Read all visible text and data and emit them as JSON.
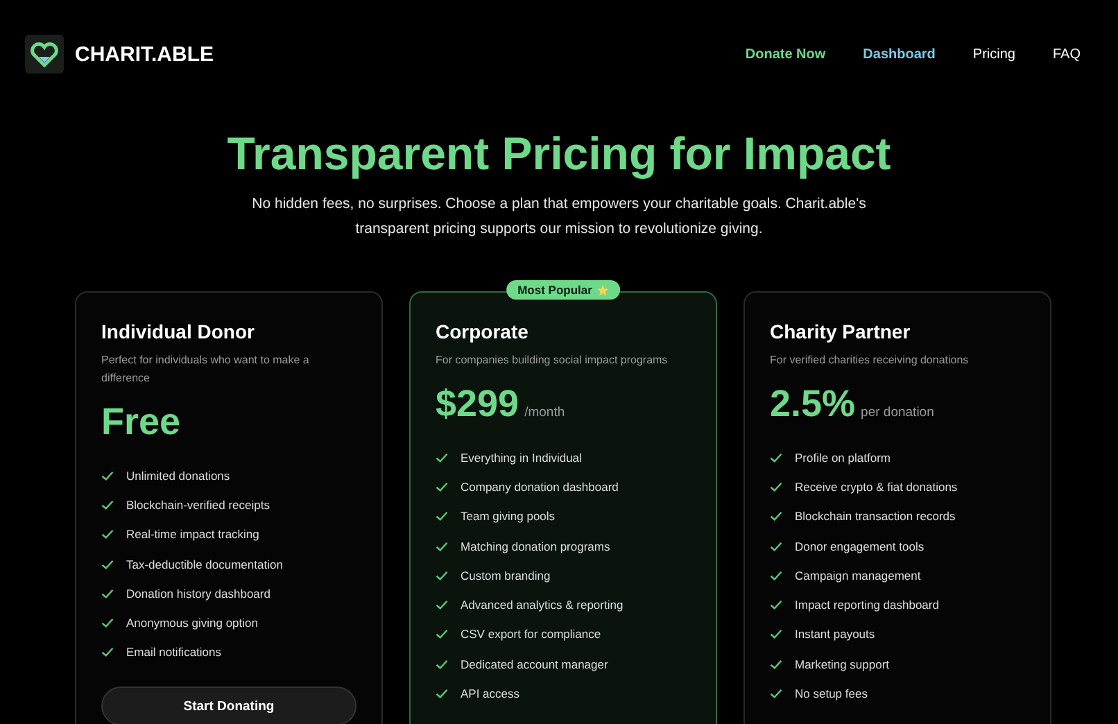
{
  "brand": {
    "name": "CHARIT.ABLE"
  },
  "nav": [
    {
      "label": "Donate Now",
      "color": "#6fd98a"
    },
    {
      "label": "Dashboard",
      "color": "#7cc9e8"
    },
    {
      "label": "Pricing",
      "color": "#ffffff"
    },
    {
      "label": "FAQ",
      "color": "#ffffff"
    }
  ],
  "hero": {
    "title": "Transparent Pricing for Impact",
    "subtitle": "No hidden fees, no surprises. Choose a plan that empowers your charitable goals. Charit.able's transparent pricing supports our mission to revolutionize giving."
  },
  "plans": [
    {
      "name": "Individual Donor",
      "description": "Perfect for individuals who want to make a difference",
      "price": "Free",
      "featured": false,
      "features": [
        "Unlimited donations",
        "Blockchain-verified receipts",
        "Real-time impact tracking",
        "Tax-deductible documentation",
        "Donation history dashboard",
        "Anonymous giving option",
        "Email notifications"
      ],
      "button": "Start Donating"
    },
    {
      "name": "Corporate",
      "description": "For companies building social impact programs",
      "price": "$299",
      "unit": "/month",
      "featured": true,
      "badge": "Most Popular",
      "features": [
        "Everything in Individual",
        "Company donation dashboard",
        "Team giving pools",
        "Matching donation programs",
        "Custom branding",
        "Advanced analytics & reporting",
        "CSV export for compliance",
        "Dedicated account manager",
        "API access"
      ]
    },
    {
      "name": "Charity Partner",
      "description": "For verified charities receiving donations",
      "price": "2.5%",
      "unit": "per donation",
      "featured": false,
      "features": [
        "Profile on platform",
        "Receive crypto & fiat donations",
        "Blockchain transaction records",
        "Donor engagement tools",
        "Campaign management",
        "Impact reporting dashboard",
        "Instant payouts",
        "Marketing support",
        "No setup fees"
      ]
    }
  ]
}
